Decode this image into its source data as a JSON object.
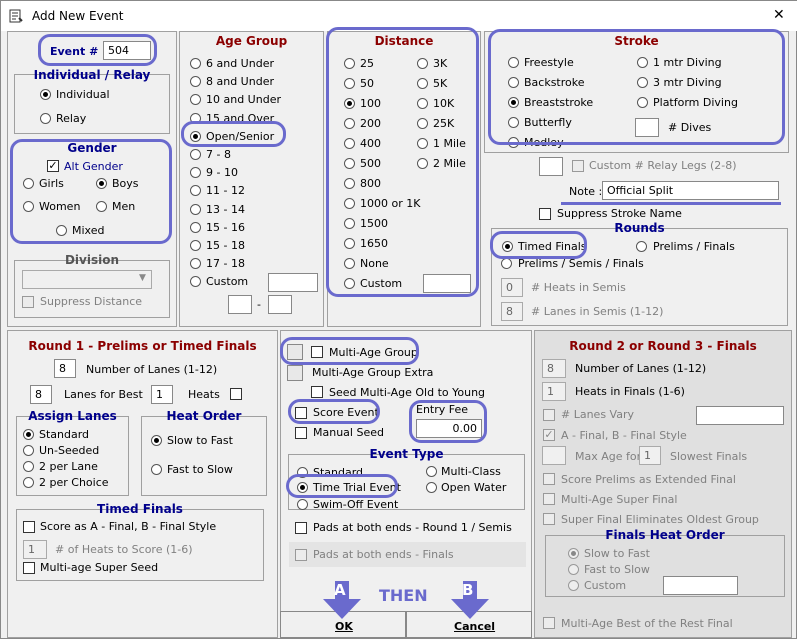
{
  "window": {
    "title": "Add New Event",
    "close": "✕"
  },
  "event": {
    "label": "Event # :",
    "value": "504"
  },
  "individual_relay": {
    "title": "Individual / Relay",
    "options": [
      "Individual",
      "Relay"
    ],
    "selected": 0
  },
  "gender": {
    "title": "Gender",
    "alt_gender": "Alt Gender",
    "girls": "Girls",
    "boys": "Boys",
    "women": "Women",
    "men": "Men",
    "mixed": "Mixed",
    "selected": "boys"
  },
  "division": {
    "title": "Division",
    "suppress": "Suppress Distance"
  },
  "age_group": {
    "title": "Age Group",
    "items": [
      "6 and Under",
      "8 and Under",
      "10 and Under",
      "15 and Over",
      "Open/Senior",
      "7 - 8",
      "9 - 10",
      "11 - 12",
      "13 - 14",
      "15 - 16",
      "15 - 18",
      "17 - 18",
      "Custom"
    ],
    "selected": 4,
    "range_sep": "-"
  },
  "distance": {
    "title": "Distance",
    "left": [
      "25",
      "50",
      "100",
      "200",
      "400",
      "500",
      "800",
      "1000 or 1K",
      "1500",
      "1650",
      "None",
      "Custom"
    ],
    "right": [
      "3K",
      "5K",
      "10K",
      "25K",
      "1 Mile",
      "2 Mile"
    ],
    "selected": "100"
  },
  "stroke": {
    "title": "Stroke",
    "left": [
      "Freestyle",
      "Backstroke",
      "Breaststroke",
      "Butterfly",
      "Medley"
    ],
    "right": [
      "1 mtr Diving",
      "3 mtr Diving",
      "Platform Diving"
    ],
    "dives": "# Dives",
    "selected": "Breaststroke"
  },
  "relay_legs": "Custom # Relay Legs (2-8)",
  "note": {
    "label": "Note :",
    "value": "Official Split"
  },
  "suppress_stroke": "Suppress Stroke Name",
  "rounds": {
    "title": "Rounds",
    "timed": "Timed Finals",
    "prelims": "Prelims / Finals",
    "psf": "Prelims / Semis / Finals",
    "heats_semis_val": "0",
    "heats_semis": "# Heats in Semis",
    "lanes_semis_val": "8",
    "lanes_semis": "# Lanes in Semis (1-12)"
  },
  "round1": {
    "title": "Round 1 - Prelims or Timed Finals",
    "lanes_val": "8",
    "lanes": "Number of Lanes (1-12)",
    "best_val": "8",
    "best": "Lanes for Best",
    "heats_val": "1",
    "heats": "Heats"
  },
  "assign_lanes": {
    "title": "Assign Lanes",
    "items": [
      "Standard",
      "Un-Seeded",
      "2 per Lane",
      "2 per Choice"
    ],
    "selected": 0
  },
  "heat_order": {
    "title": "Heat Order",
    "items": [
      "Slow to Fast",
      "Fast to Slow"
    ],
    "selected": 0
  },
  "timed_finals": {
    "title": "Timed Finals",
    "score_ab": "Score as A - Final, B - Final Style",
    "heats_val": "1",
    "heats_score": "# of Heats to Score (1-6)",
    "super_seed": "Multi-age Super Seed"
  },
  "middle": {
    "multi_age": "Multi-Age Group",
    "multi_age_extra": "Multi-Age Group Extra",
    "seed_old": "Seed Multi-Age Old to Young",
    "score_event": "Score Event",
    "manual_seed": "Manual Seed",
    "entry_fee_label": "Entry Fee",
    "entry_fee": "0.00"
  },
  "event_type": {
    "title": "Event Type",
    "standard": "Standard",
    "multi_class": "Multi-Class",
    "time_trial": "Time Trial Event",
    "open_water": "Open Water",
    "swim_off": "Swim-Off Event",
    "selected": "time_trial"
  },
  "pads": {
    "r1": "Pads at both ends - Round 1 / Semis",
    "finals": "Pads at both ends - Finals"
  },
  "round23": {
    "title": "Round 2 or Round 3 - Finals",
    "lanes_val": "8",
    "lanes": "Number of Lanes (1-12)",
    "heats_val": "1",
    "heats": "Heats in Finals (1-6)",
    "lanes_vary": "# Lanes Vary",
    "ab_final": "A - Final, B - Final Style",
    "max_age": "Max Age for",
    "slowest_val": "1",
    "slowest": "Slowest Finals",
    "score_prelims": "Score Prelims as Extended Final",
    "super_final": "Multi-Age Super Final",
    "eliminates": "Super Final Eliminates Oldest Group",
    "best_rest": "Multi-Age Best of the Rest Final"
  },
  "finals_heat_order": {
    "title": "Finals Heat Order",
    "items": [
      "Slow to Fast",
      "Fast to Slow",
      "Custom"
    ],
    "selected": 0
  },
  "buttons": {
    "ok": "OK",
    "cancel": "Cancel"
  },
  "annotations": {
    "a": "A",
    "b": "B",
    "then": "THEN"
  },
  "colors": {
    "annotation": "#6a6acd",
    "group_title": "#8b0000",
    "subgroup_title": "#00008b"
  }
}
